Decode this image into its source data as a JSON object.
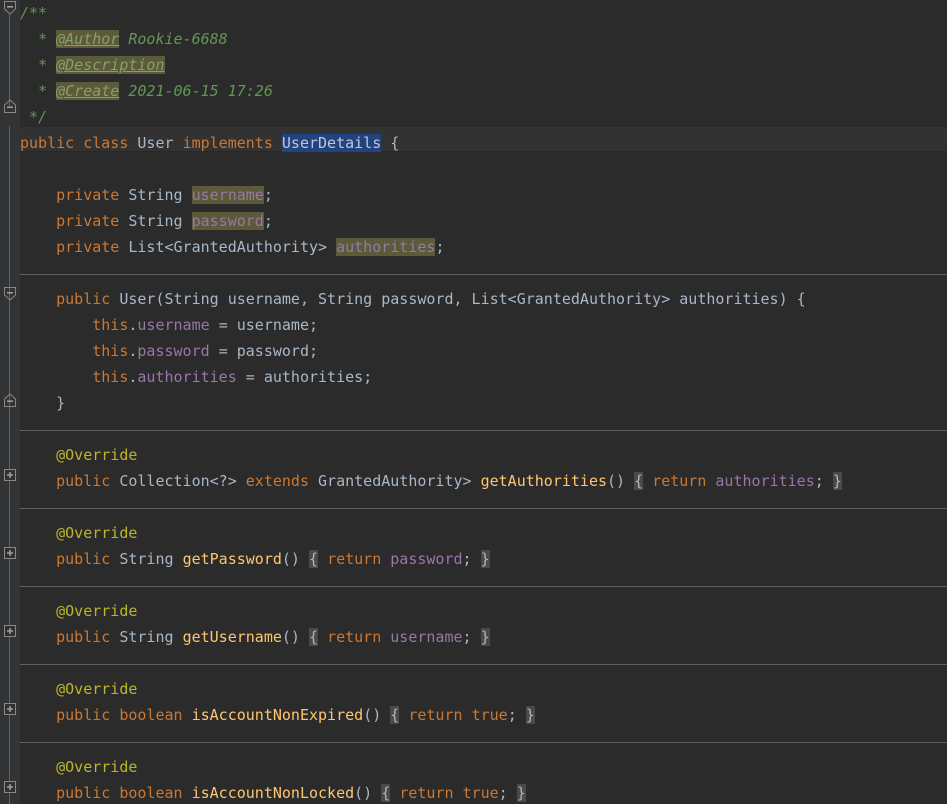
{
  "theme": {
    "name": "Darcula",
    "editor_bg": "#2B2B2B",
    "gutter_bg": "#313335",
    "caret_line_bg": "#323232",
    "selection_bg": "#214283",
    "identifier_highlight_bg": "#5B5B39",
    "fold_brace_bg": "#4A4A4A",
    "separator": "#5F5F5F",
    "keyword": "#CC7832",
    "type": "#A9B7C6",
    "field": "#9876AA",
    "method": "#FFC66D",
    "annotation": "#BBB529",
    "comment": "#629755"
  },
  "file": {
    "language": "Java",
    "class_name": "User",
    "implements": "UserDetails"
  },
  "javadoc": {
    "open": "/**",
    "star": "*",
    "close": "*/",
    "tags": [
      {
        "tag": "@Author",
        "value": "Rookie-6688"
      },
      {
        "tag": "@Description",
        "value": ""
      },
      {
        "tag": "@Create",
        "value": "2021-06-15 17:26"
      }
    ]
  },
  "tokens": {
    "public": "public",
    "private": "private",
    "class": "class",
    "implements": "implements",
    "extends": "extends",
    "return": "return",
    "boolean": "boolean",
    "true": "true",
    "this": "this",
    "string_type": "String",
    "list_type": "List<GrantedAuthority>",
    "collection_type": "Collection<?>",
    "granted_authority": "GrantedAuthority>",
    "semicolon": ";",
    "open_brace": "{",
    "close_brace": "}",
    "equals": "=",
    "comma": ",",
    "open_paren": "(",
    "close_paren": ")",
    "parens_empty": "()",
    "dot": "."
  },
  "fields": [
    {
      "modifier": "private",
      "type": "String",
      "name": "username"
    },
    {
      "modifier": "private",
      "type": "String",
      "name": "password"
    },
    {
      "modifier": "private",
      "type": "List<GrantedAuthority>",
      "name": "authorities"
    }
  ],
  "constructor": {
    "modifier": "public",
    "name": "User",
    "params": "(String username, String password, List<GrantedAuthority> authorities) {",
    "assignments": [
      {
        "lhs_field": "username",
        "rhs": "username"
      },
      {
        "lhs_field": "password",
        "rhs": "password"
      },
      {
        "lhs_field": "authorities",
        "rhs": "authorities"
      }
    ]
  },
  "annotations": {
    "override": "@Override"
  },
  "methods": [
    {
      "annotation": "@Override",
      "modifier": "public",
      "return_type": "Collection<? extends GrantedAuthority>",
      "name": "getAuthorities",
      "body_keyword": "return",
      "body_value": "authorities",
      "folded": true
    },
    {
      "annotation": "@Override",
      "modifier": "public",
      "return_type": "String",
      "name": "getPassword",
      "body_keyword": "return",
      "body_value": "password",
      "folded": true
    },
    {
      "annotation": "@Override",
      "modifier": "public",
      "return_type": "String",
      "name": "getUsername",
      "body_keyword": "return",
      "body_value": "username",
      "folded": true
    },
    {
      "annotation": "@Override",
      "modifier": "public",
      "return_type": "boolean",
      "name": "isAccountNonExpired",
      "body_keyword": "return",
      "body_value": "true",
      "folded": true
    },
    {
      "annotation": "@Override",
      "modifier": "public",
      "return_type": "boolean",
      "name": "isAccountNonLocked",
      "body_keyword": "return",
      "body_value": "true",
      "folded": true
    }
  ],
  "gutter": {
    "fold_collapse_label": "-",
    "fold_expand_label": "+"
  }
}
